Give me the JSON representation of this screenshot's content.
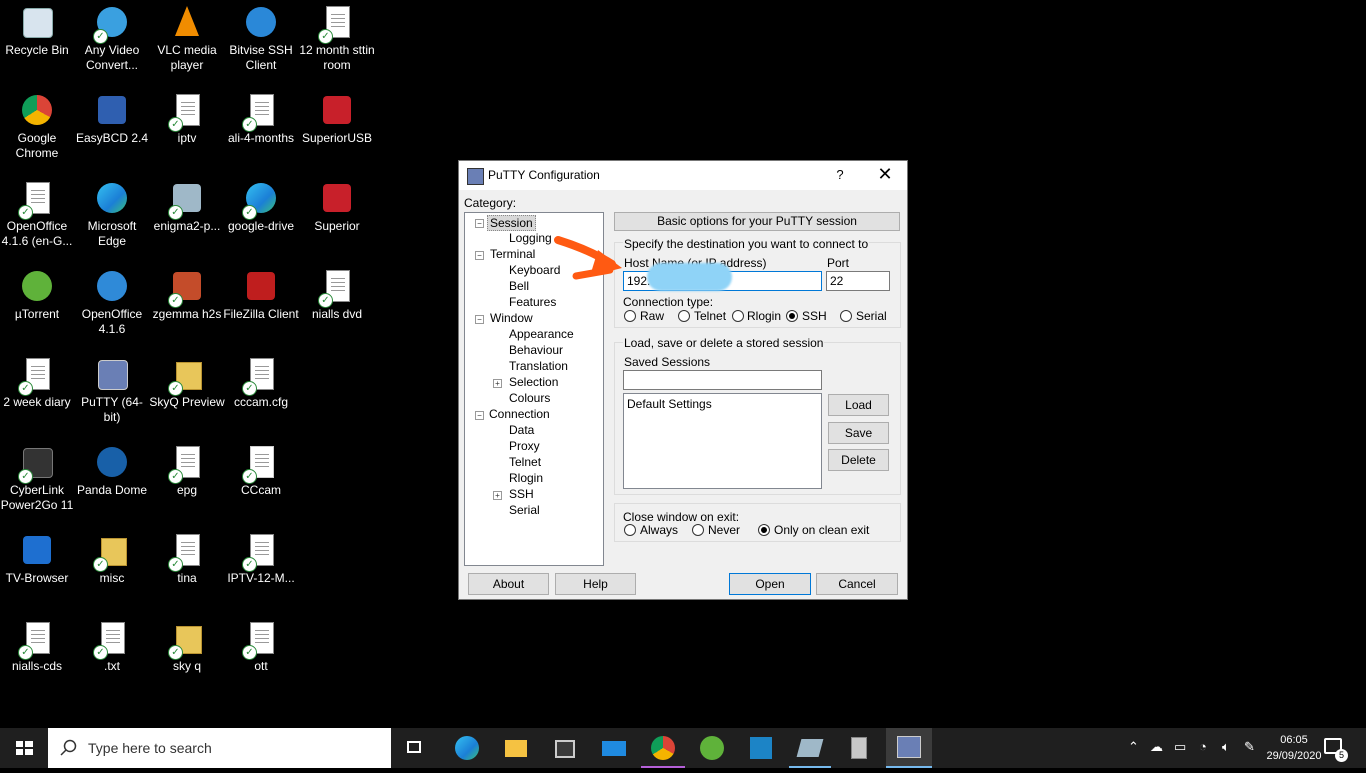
{
  "desktop_icons": [
    {
      "label": "Recycle Bin"
    },
    {
      "label": "Any Video Convert..."
    },
    {
      "label": "VLC media player"
    },
    {
      "label": "Bitvise SSH Client"
    },
    {
      "label": "12 month sttin room"
    },
    {
      "label": "Google Chrome"
    },
    {
      "label": "EasyBCD 2.4"
    },
    {
      "label": "iptv"
    },
    {
      "label": "ali-4-months"
    },
    {
      "label": "SuperiorUSB"
    },
    {
      "label": "OpenOffice 4.1.6 (en-G..."
    },
    {
      "label": "Microsoft Edge"
    },
    {
      "label": "enigma2-p..."
    },
    {
      "label": "google-drive"
    },
    {
      "label": "Superior"
    },
    {
      "label": "µTorrent"
    },
    {
      "label": "OpenOffice 4.1.6"
    },
    {
      "label": "zgemma h2s"
    },
    {
      "label": "FileZilla Client"
    },
    {
      "label": "nialls dvd"
    },
    {
      "label": "2 week diary"
    },
    {
      "label": "PuTTY (64-bit)"
    },
    {
      "label": "SkyQ Preview"
    },
    {
      "label": "cccam.cfg"
    },
    {
      "label": "CyberLink Power2Go 11"
    },
    {
      "label": "Panda Dome"
    },
    {
      "label": "epg"
    },
    {
      "label": "CCcam"
    },
    {
      "label": "TV-Browser"
    },
    {
      "label": "misc"
    },
    {
      "label": "tina"
    },
    {
      "label": "IPTV-12-M..."
    },
    {
      "label": "nialls-cds"
    },
    {
      "label": ".txt"
    },
    {
      "label": "sky q"
    },
    {
      "label": "ott"
    }
  ],
  "putty": {
    "title": "PuTTY Configuration",
    "help_glyph": "?",
    "close_glyph": "✕",
    "category_label": "Category:",
    "tree": {
      "session": "Session",
      "logging": "Logging",
      "terminal": "Terminal",
      "keyboard": "Keyboard",
      "bell": "Bell",
      "features": "Features",
      "window": "Window",
      "appearance": "Appearance",
      "behaviour": "Behaviour",
      "translation": "Translation",
      "selection": "Selection",
      "colours": "Colours",
      "connection": "Connection",
      "data": "Data",
      "proxy": "Proxy",
      "telnet": "Telnet",
      "rlogin": "Rlogin",
      "ssh": "SSH",
      "serial": "Serial"
    },
    "header_button": "Basic options for your PuTTY session",
    "destination_label": "Specify the destination you want to connect to",
    "host_label": "Host Name (or IP address)",
    "host_value": "192.",
    "port_label": "Port",
    "port_value": "22",
    "conn_type_label": "Connection type:",
    "conn_types": {
      "raw": "Raw",
      "telnet": "Telnet",
      "rlogin": "Rlogin",
      "ssh": "SSH",
      "serial": "Serial"
    },
    "conn_selected": "SSH",
    "sessions_group_label": "Load, save or delete a stored session",
    "saved_sessions_label": "Saved Sessions",
    "saved_sessions_value": "",
    "sessions_list": [
      "Default Settings"
    ],
    "load": "Load",
    "save": "Save",
    "delete": "Delete",
    "close_label": "Close window on exit:",
    "close_options": {
      "always": "Always",
      "never": "Never",
      "clean": "Only on clean exit"
    },
    "close_selected": "Only on clean exit",
    "about": "About",
    "help": "Help",
    "open": "Open",
    "cancel": "Cancel"
  },
  "taskbar": {
    "search_placeholder": "Type here to search",
    "time": "06:05",
    "date": "29/09/2020",
    "notification_count": "5"
  },
  "annotation_color": "#ff5a12",
  "redaction_color": "#8fd3f7"
}
